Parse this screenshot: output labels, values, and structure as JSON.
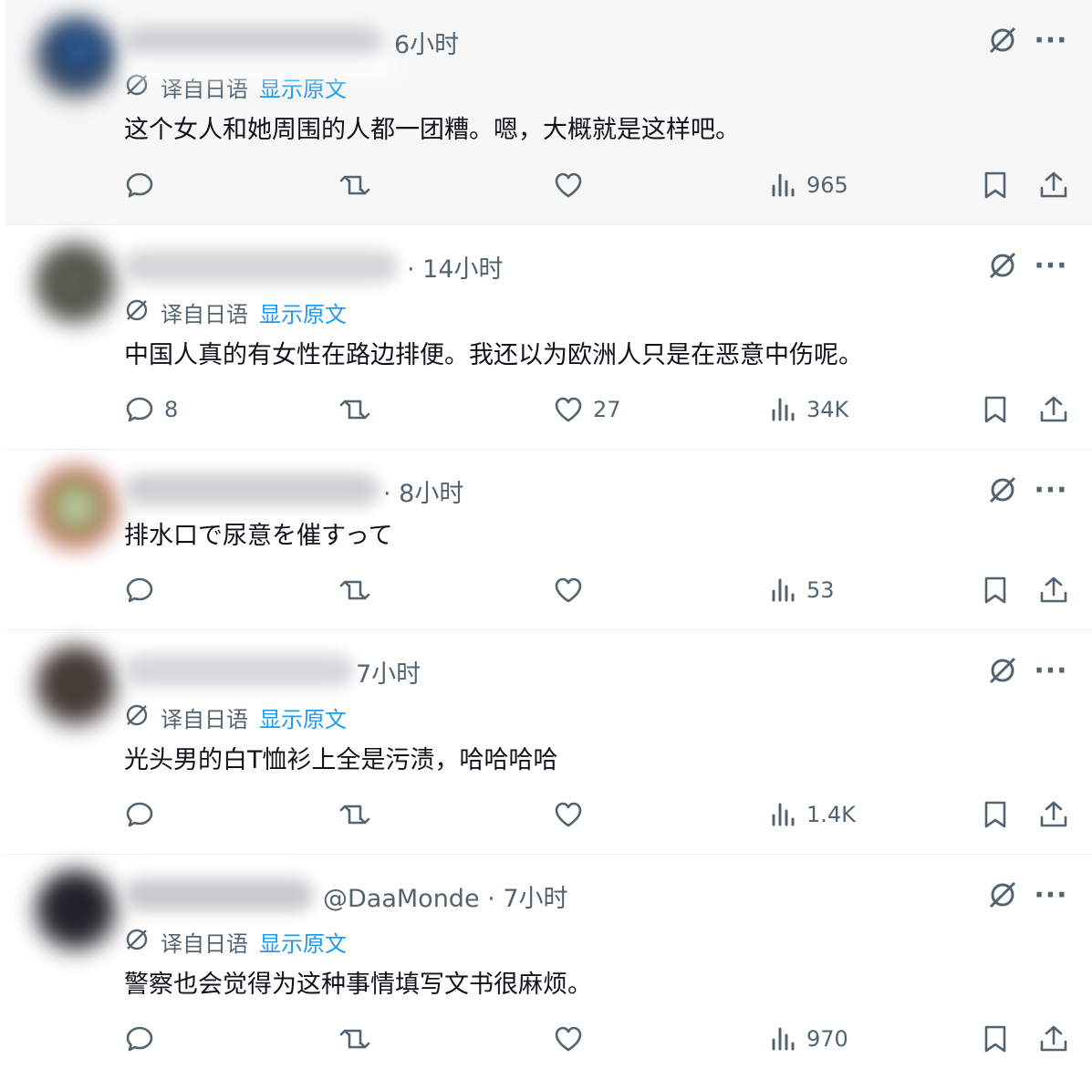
{
  "posts": [
    {
      "time": "6小时",
      "handle": "",
      "translate_label": "译自日语",
      "show_original": "显示原文",
      "text": "这个女人和她周围的人都一团糟。嗯，大概就是这样吧。",
      "replies": "",
      "likes": "",
      "views": "965"
    },
    {
      "time": "· 14小时",
      "handle": "",
      "translate_label": "译自日语",
      "show_original": "显示原文",
      "text": "中国人真的有女性在路边排便。我还以为欧洲人只是在恶意中伤呢。",
      "replies": "8",
      "likes": "27",
      "views": "34K"
    },
    {
      "time": "· 8小时",
      "handle": "",
      "text": "排水口で尿意を催すって",
      "replies": "",
      "likes": "",
      "views": "53"
    },
    {
      "time": "7小时",
      "handle": "",
      "translate_label": "译自日语",
      "show_original": "显示原文",
      "text": "光头男的白T恤衫上全是污渍，哈哈哈哈",
      "replies": "",
      "likes": "",
      "views": "1.4K"
    },
    {
      "time": "· 7小时",
      "handle": "@DaaMonde",
      "translate_label": "译自日语",
      "show_original": "显示原文",
      "text": "警察也会觉得为这种事情填写文书很麻烦。",
      "replies": "",
      "likes": "",
      "views": "970"
    }
  ],
  "more_label": "···",
  "colors": {
    "text": "#0f1419",
    "muted": "#536471",
    "link": "#1d9bf0",
    "highlight_bg": "#f7f7f7",
    "divider": "#eff3f4"
  },
  "icons": [
    "grok-icon",
    "more-icon",
    "reply-icon",
    "retweet-icon",
    "like-icon",
    "views-icon",
    "bookmark-icon",
    "share-icon",
    "translate-icon"
  ]
}
